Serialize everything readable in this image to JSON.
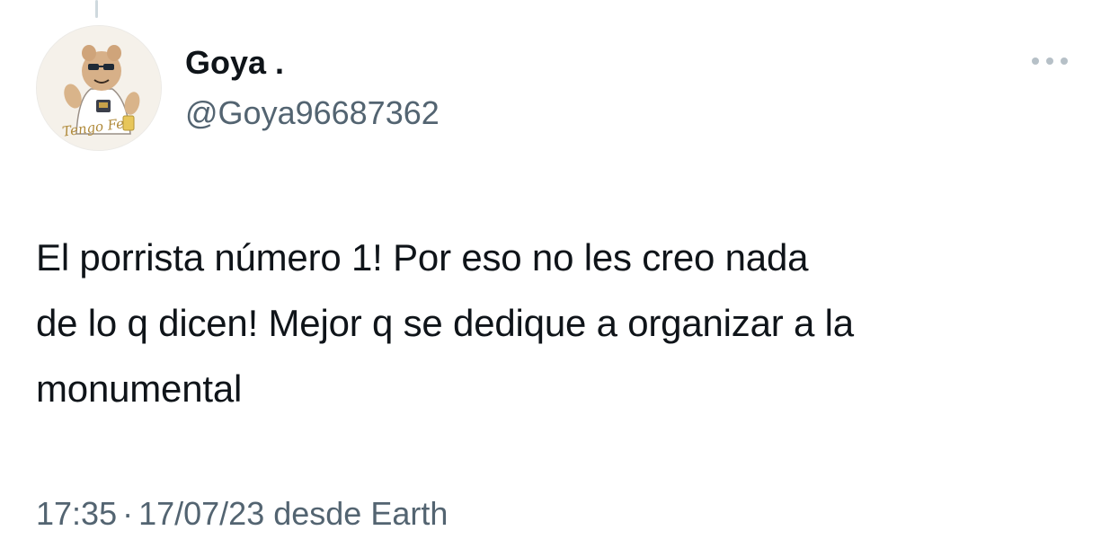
{
  "tweet": {
    "author": {
      "display_name": "Goya .",
      "handle": "@Goya96687362",
      "avatar_caption": "Tengo Fe"
    },
    "text_lines": [
      "El porrista número 1! Por eso no les creo nada",
      "de lo q dicen! Mejor q se dedique a organizar a la",
      "monumental"
    ],
    "time": "17:35",
    "separator": "·",
    "date_source": "17/07/23 desde Earth",
    "more_icon": "more-horizontal-icon"
  },
  "colors": {
    "text": "#0f1419",
    "secondary": "#536471",
    "thread_line": "#cfd9de",
    "background": "#ffffff"
  }
}
